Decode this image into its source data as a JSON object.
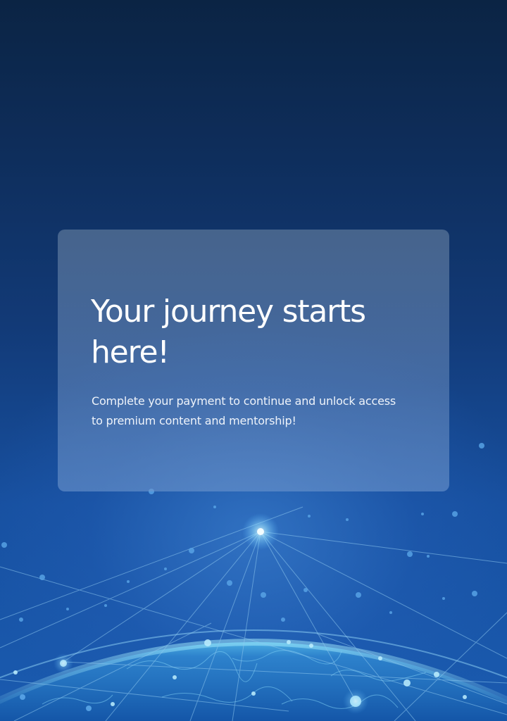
{
  "card": {
    "title": "Your journey starts here!",
    "subtitle": "Complete your payment to continue and unlock access to premium content and mentorship!"
  },
  "background": {
    "art": "globe-network-icon",
    "colors": {
      "top": "#0b2444",
      "bottom": "#1a5bb0",
      "glow": "#7fd6ff",
      "line": "#8fc7f0"
    }
  }
}
